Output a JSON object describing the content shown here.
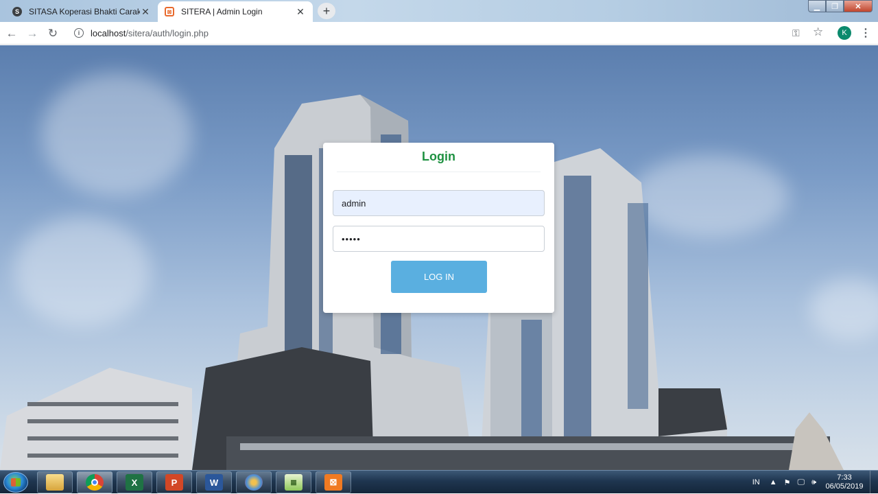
{
  "browser": {
    "tabs": [
      {
        "title": "SITASA Koperasi Bhakti Caraka",
        "favicon": "S",
        "active": false
      },
      {
        "title": "SITERA | Admin Login",
        "favicon": "xampp",
        "active": true
      }
    ],
    "new_tab_icon": "plus-icon",
    "url_host": "localhost",
    "url_path": "/sitera/auth/login.php",
    "profile_initial": "K"
  },
  "login": {
    "title": "Login",
    "username_value": "admin",
    "password_value": "•••••",
    "button_label": "LOG IN",
    "title_color": "#1e9141",
    "button_color": "#5aafe0"
  },
  "taskbar": {
    "apps": [
      {
        "name": "file-explorer",
        "icon": "folder-icon"
      },
      {
        "name": "chrome",
        "icon": "chrome-icon"
      },
      {
        "name": "excel",
        "icon": "excel-icon",
        "glyph": "X"
      },
      {
        "name": "powerpoint",
        "icon": "powerpoint-icon",
        "glyph": "P"
      },
      {
        "name": "word",
        "icon": "word-icon",
        "glyph": "W"
      },
      {
        "name": "paint",
        "icon": "paint-icon"
      },
      {
        "name": "notepad-plus-plus",
        "icon": "notepad-icon"
      },
      {
        "name": "xampp",
        "icon": "xampp-icon"
      }
    ],
    "language": "IN",
    "time": "7:33",
    "date": "06/05/2019"
  }
}
